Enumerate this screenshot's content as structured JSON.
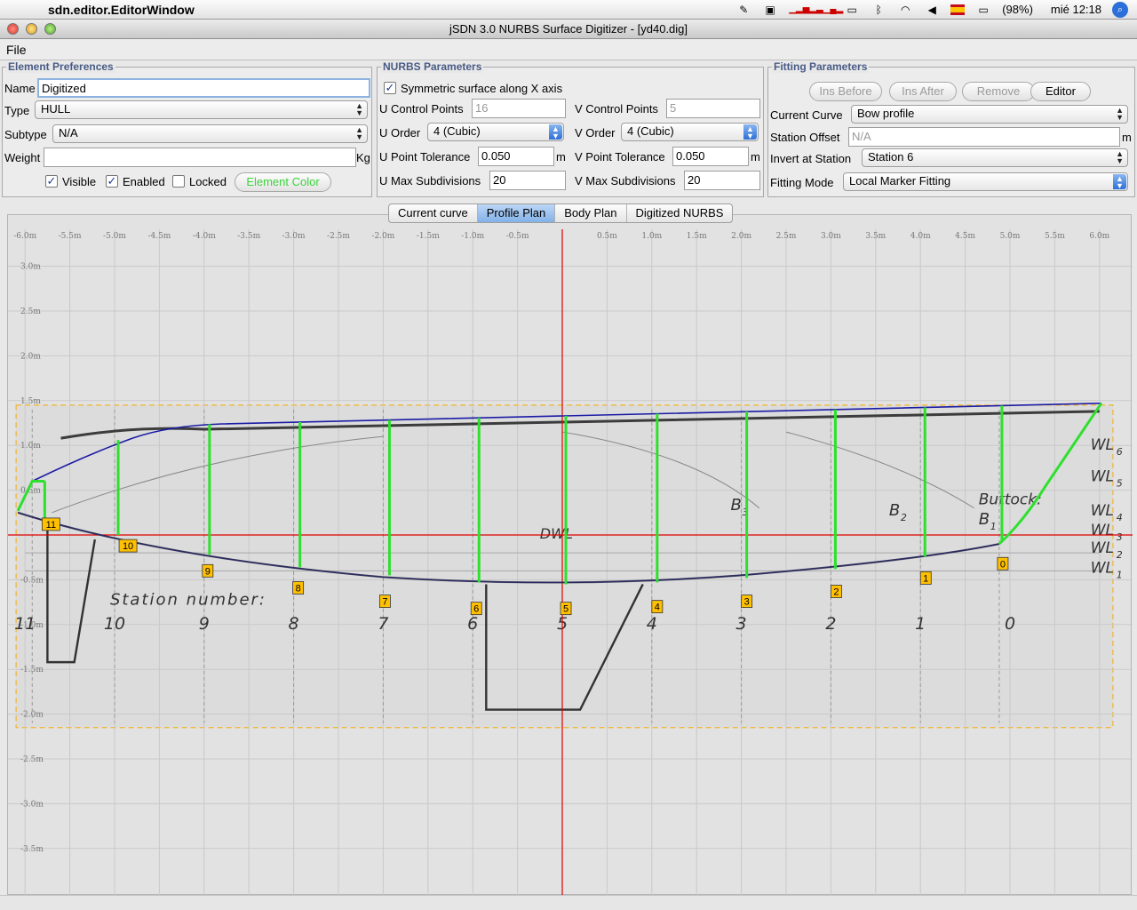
{
  "menubar": {
    "app_name": "sdn.editor.EditorWindow",
    "battery": "(98%)",
    "clock": "mié 12:18"
  },
  "window": {
    "title": "jSDN 3.0 NURBS Surface Digitizer - [yd40.dig]"
  },
  "menu": {
    "file": "File"
  },
  "element_prefs": {
    "legend": "Element Preferences",
    "name_label": "Name",
    "name_value": "Digitized",
    "type_label": "Type",
    "type_value": "HULL",
    "subtype_label": "Subtype",
    "subtype_value": "N/A",
    "weight_label": "Weight",
    "weight_value": "",
    "weight_unit": "Kg",
    "visible_label": "Visible",
    "enabled_label": "Enabled",
    "locked_label": "Locked",
    "color_button": "Element Color"
  },
  "nurbs": {
    "legend": "NURBS Parameters",
    "symmetric_label": "Symmetric surface along X axis",
    "u_cp_label": "U Control Points",
    "u_cp_value": "16",
    "v_cp_label": "V Control Points",
    "v_cp_value": "5",
    "u_order_label": "U Order",
    "u_order_value": "4 (Cubic)",
    "v_order_label": "V Order",
    "v_order_value": "4 (Cubic)",
    "u_tol_label": "U Point Tolerance",
    "u_tol_value": "0.050",
    "u_tol_unit": "m",
    "v_tol_label": "V Point Tolerance",
    "v_tol_value": "0.050",
    "v_tol_unit": "m",
    "u_sub_label": "U Max Subdivisions",
    "u_sub_value": "20",
    "v_sub_label": "V Max Subdivisions",
    "v_sub_value": "20"
  },
  "fitting": {
    "legend": "Fitting Parameters",
    "ins_before": "Ins Before",
    "ins_after": "Ins After",
    "remove": "Remove",
    "editor": "Editor",
    "curve_label": "Current Curve",
    "curve_value": "Bow profile",
    "offset_label": "Station Offset",
    "offset_value": "N/A",
    "offset_unit": "m",
    "invert_label": "Invert at Station",
    "invert_value": "Station 6",
    "mode_label": "Fitting Mode",
    "mode_value": "Local Marker Fitting"
  },
  "tabs": [
    "Current curve",
    "Profile Plan",
    "Body Plan",
    "Digitized NURBS"
  ],
  "plan": {
    "x_ticks": [
      "-6.0m",
      "-5.5m",
      "-5.0m",
      "-4.5m",
      "-4.0m",
      "-3.5m",
      "-3.0m",
      "-2.5m",
      "-2.0m",
      "-1.5m",
      "-1.0m",
      "-0.5m",
      "",
      "0.5m",
      "1.0m",
      "1.5m",
      "2.0m",
      "2.5m",
      "3.0m",
      "3.5m",
      "4.0m",
      "4.5m",
      "5.0m",
      "5.5m",
      "6.0m"
    ],
    "y_ticks": [
      "3.0m",
      "2.5m",
      "2.0m",
      "1.5m",
      "1.0m",
      "0.5m",
      "",
      "-0.5m",
      "-1.0m",
      "-1.5m",
      "-2.0m",
      "-2.5m",
      "-3.0m",
      "-3.5m"
    ],
    "station_markers": [
      "11",
      "10",
      "9",
      "8",
      "7",
      "6",
      "5",
      "4",
      "3",
      "2",
      "1",
      "0"
    ],
    "drawing_labels": {
      "station_number": "Station number:",
      "dwl": "DWL",
      "buttock": "Buttock:",
      "b1": "B",
      "b2": "B",
      "b3": "B",
      "wl": "WL"
    },
    "drawing_station_numbers": [
      "11",
      "10",
      "9",
      "8",
      "7",
      "6",
      "5",
      "4",
      "3",
      "2",
      "1",
      "0"
    ],
    "colors": {
      "axis": "#e00000",
      "curve": "#1b1ba6",
      "station_line": "#2ee02e",
      "marker_fill": "#ffc000",
      "frame": "#f2b42a"
    }
  }
}
